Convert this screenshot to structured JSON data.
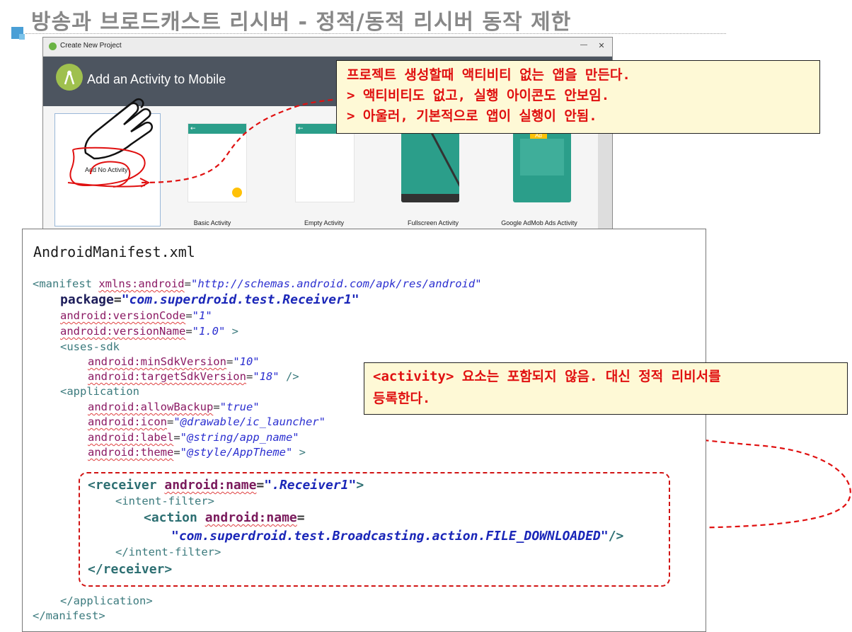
{
  "slide": {
    "title": "방송과 브로드캐스트 리시버 - 정적/동적 리시버 동작 제한"
  },
  "dialog": {
    "window_title": "Create New Project",
    "minimize_glyph": "—",
    "close_glyph": "✕",
    "header_title": "Add an Activity to Mobile",
    "tiles": [
      {
        "label": "Add No Activity"
      },
      {
        "label": "Basic Activity"
      },
      {
        "label": "Empty Activity"
      },
      {
        "label": "Fullscreen Activity"
      },
      {
        "label": "Google AdMob Ads Activity"
      }
    ],
    "back_glyph": "←",
    "ad_badge": "Ad"
  },
  "callouts": {
    "top": [
      "프로젝트 생성할때 액티비티 없는 앱을 만든다.",
      "> 액티비티도 없고, 실행 아이콘도 안보임.",
      "> 아울러, 기본적으로 앱이 실행이 안됨."
    ],
    "bottom": [
      "<activity> 요소는 포함되지 않음. 대신 정적 리비서를",
      "등록한다."
    ]
  },
  "manifest": {
    "heading": "AndroidManifest.xml",
    "lines": {
      "l1": {
        "tag": "<manifest ",
        "attr": "xmlns:android",
        "eq": "=",
        "val": "\"http://schemas.android.com/apk/res/android\""
      },
      "l2": {
        "attr": "package",
        "eq": "=",
        "val": "\"com.superdroid.test.Receiver1\""
      },
      "l3": {
        "attr": "android:versionCode",
        "eq": "=",
        "val": "\"1\""
      },
      "l4": {
        "attr": "android:versionName",
        "eq": "=",
        "val": "\"1.0\"",
        "end": " >"
      },
      "l5": {
        "tag": "<uses-sdk"
      },
      "l6": {
        "attr": "android:minSdkVersion",
        "eq": "=",
        "val": "\"10\""
      },
      "l7": {
        "attr": "android:targetSdkVersion",
        "eq": "=",
        "val": "\"18\"",
        "end": " />"
      },
      "l8": {
        "tag": "<application"
      },
      "l9": {
        "attr": "android:allowBackup",
        "eq": "=",
        "val": "\"true\""
      },
      "l10": {
        "attr": "android:icon",
        "eq": "=",
        "val": "\"@drawable/ic_launcher\""
      },
      "l11": {
        "attr": "android:label",
        "eq": "=",
        "val": "\"@string/app_name\""
      },
      "l12": {
        "attr": "android:theme",
        "eq": "=",
        "val": "\"@style/AppTheme\"",
        "end": " >"
      },
      "l13": {
        "tag": "<receiver ",
        "attr": "android:name",
        "eq": "=",
        "val": "\".Receiver1\"",
        "end": ">"
      },
      "l14": {
        "tag": "<intent-filter>"
      },
      "l15": {
        "tag": "<action ",
        "attr": "android:name",
        "eq": "="
      },
      "l16": {
        "val": "\"com.superdroid.test.Broadcasting.action.FILE_DOWNLOADED\"",
        "end": "/>"
      },
      "l17": {
        "tag": "</intent-filter>"
      },
      "l18": {
        "tag": "</receiver>"
      },
      "l19": {
        "tag": "</application>"
      },
      "l20": {
        "tag": "</manifest>"
      }
    }
  },
  "colors": {
    "annotation_red": "#e01010",
    "callout_bg": "#fef9d6",
    "android_teal": "#2b9e8a",
    "header_gray": "#4d5560"
  }
}
